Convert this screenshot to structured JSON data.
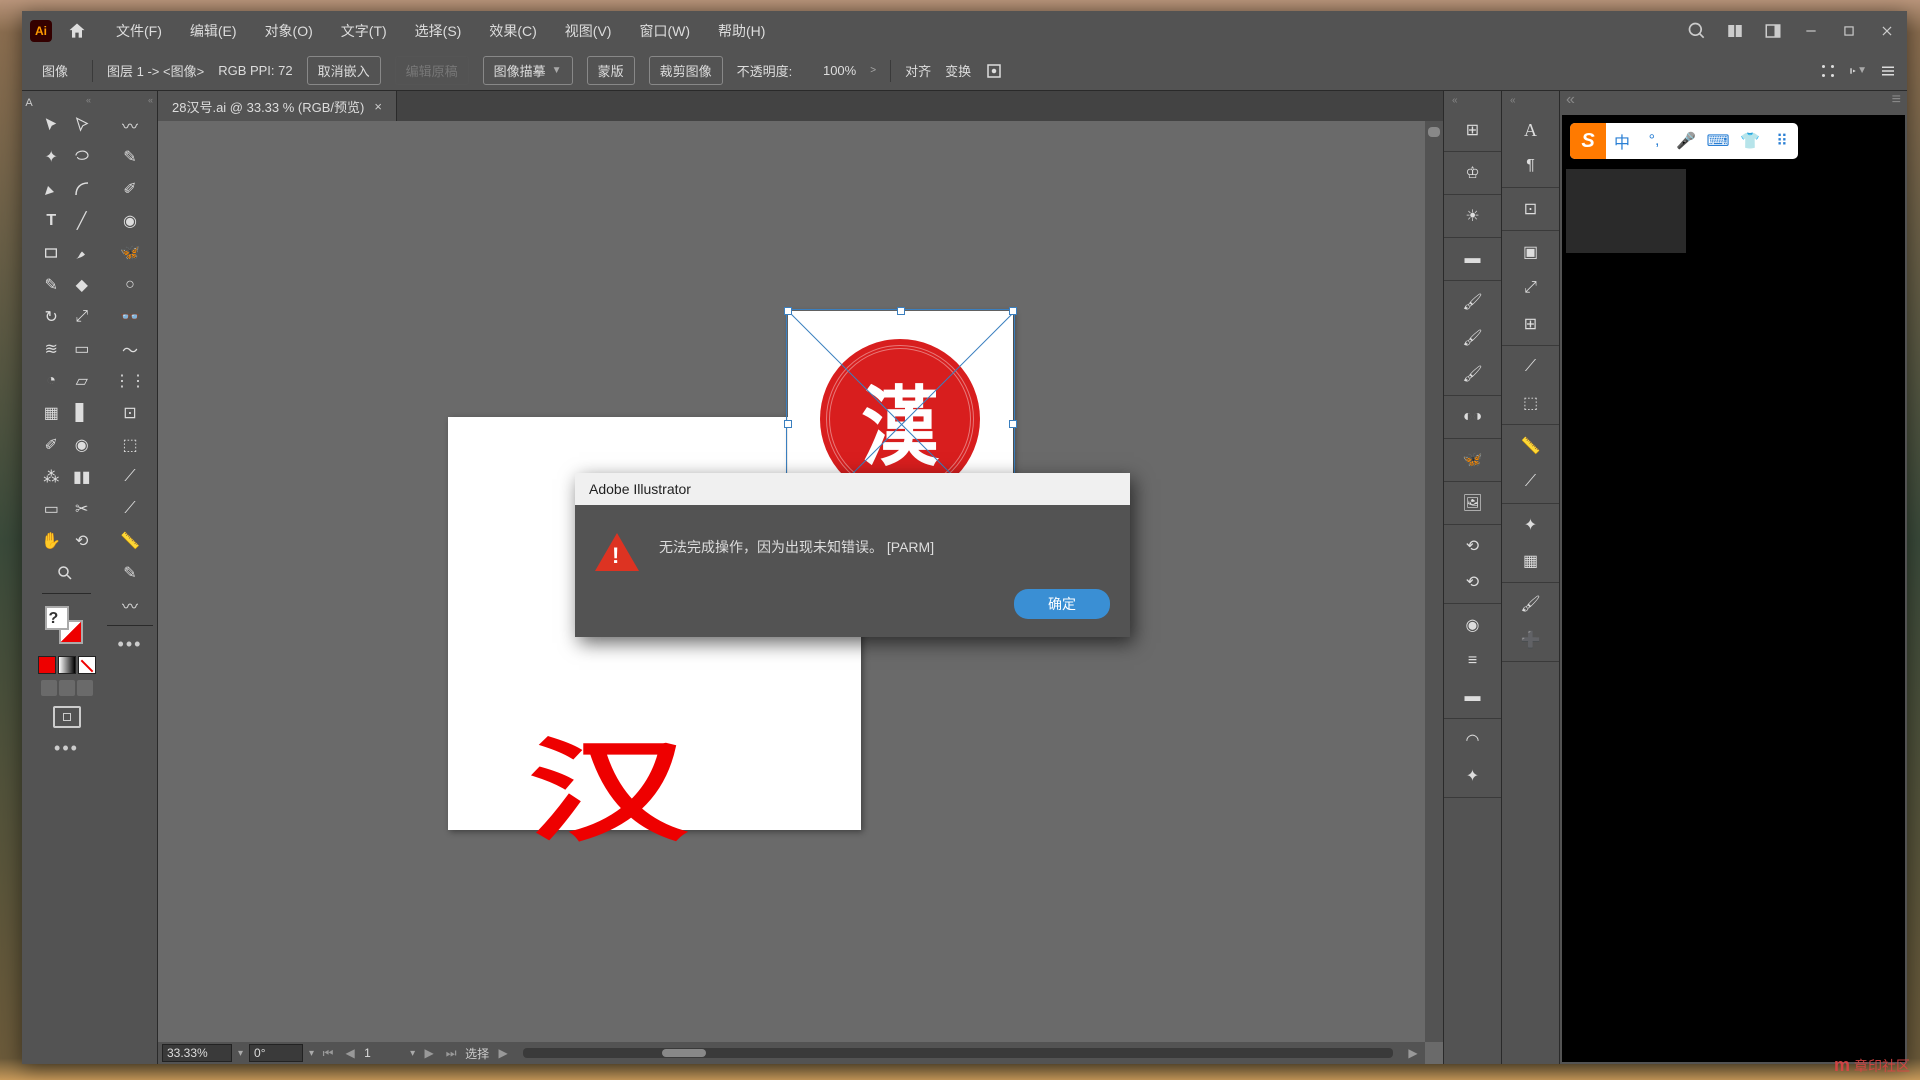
{
  "menu": {
    "file": "文件(F)",
    "edit": "编辑(E)",
    "object": "对象(O)",
    "type": "文字(T)",
    "select": "选择(S)",
    "effect": "效果(C)",
    "view": "视图(V)",
    "window": "窗口(W)",
    "help": "帮助(H)"
  },
  "control": {
    "image_label": "图像",
    "layer_info": "图层 1 -> <图像>",
    "color_info": "RGB PPI: 72",
    "unembed": "取消嵌入",
    "edit_original": "编辑原稿",
    "image_trace": "图像描摹",
    "mask": "蒙版",
    "crop": "裁剪图像",
    "opacity_label": "不透明度:",
    "opacity_value": "100%",
    "align": "对齐",
    "transform": "变换"
  },
  "doc": {
    "tab_title": "28汉号.ai @ 33.33 % (RGB/预览)"
  },
  "status": {
    "zoom": "33.33%",
    "rotation": "0°",
    "artboard": "1",
    "select_label": "选择"
  },
  "dialog": {
    "title": "Adobe Illustrator",
    "message": "无法完成操作，因为出现未知错误。  [PARM]",
    "ok": "确定"
  },
  "ime": {
    "lang": "中",
    "dot": "°,"
  },
  "artwork": {
    "han": "汉"
  },
  "watermark": "章印社区"
}
